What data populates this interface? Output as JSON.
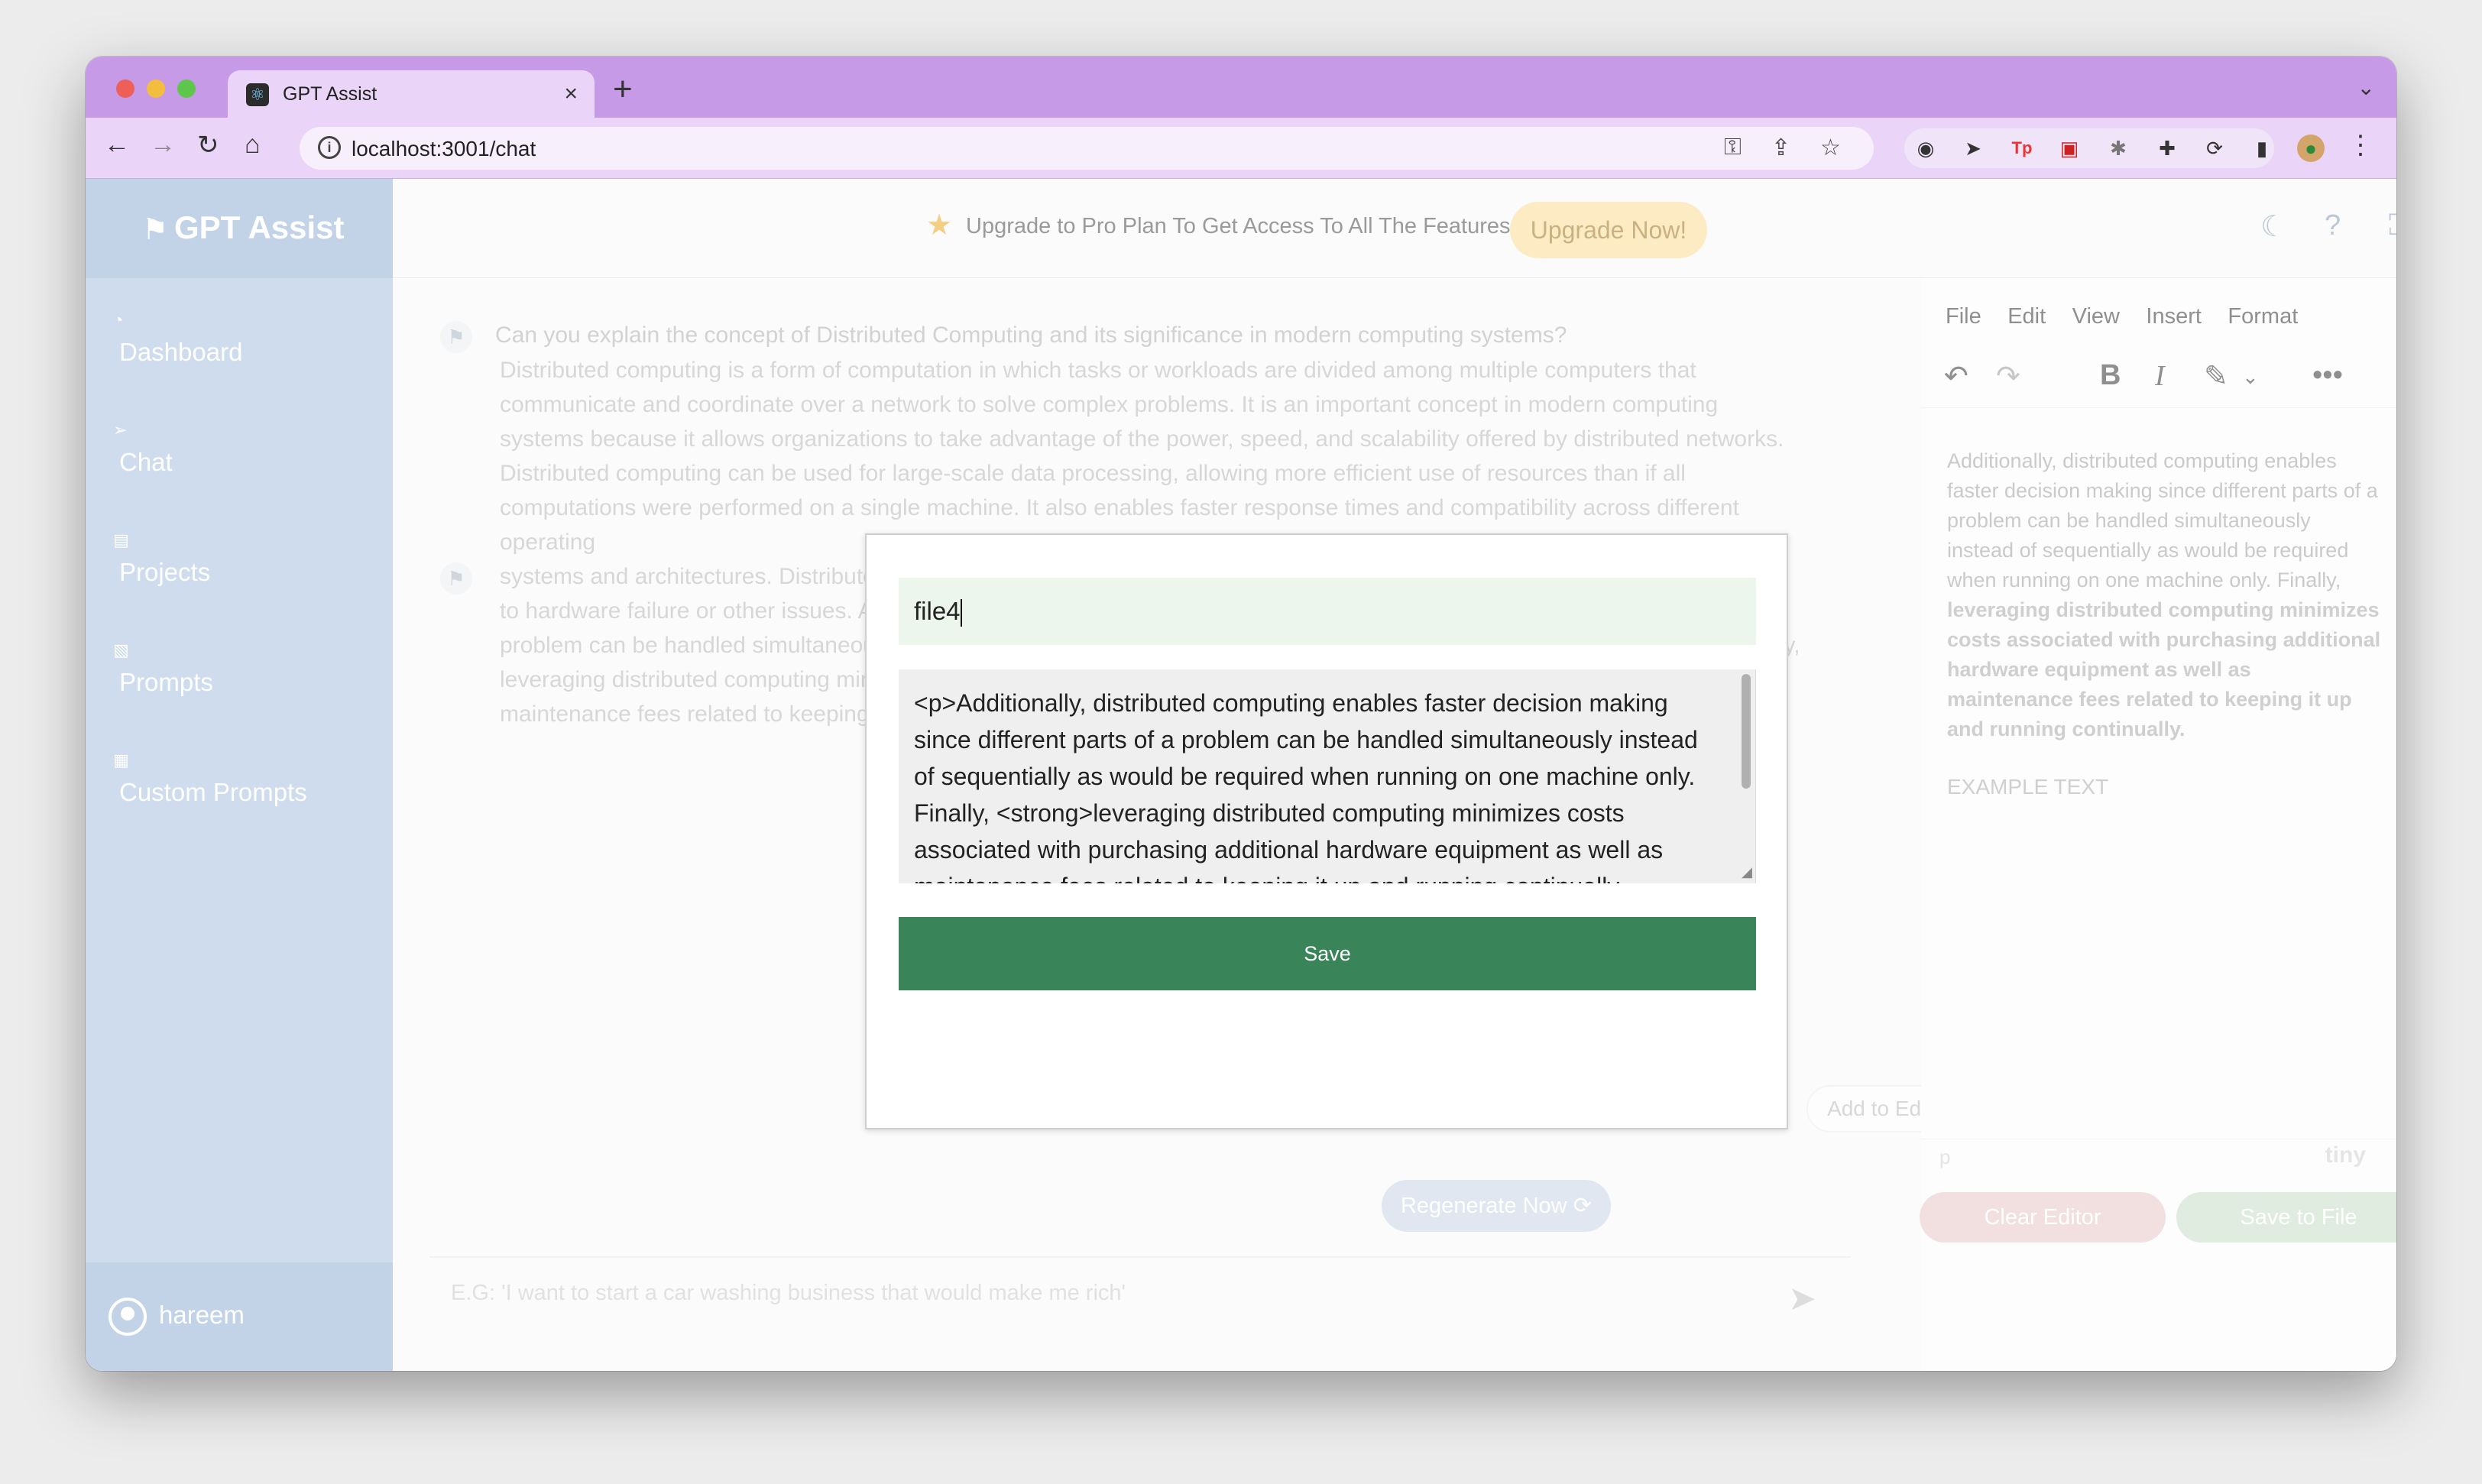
{
  "browser": {
    "tab_title": "GPT Assist",
    "tab_favicon": "react-icon",
    "url": "localhost:3001/chat",
    "close_glyph": "×",
    "new_tab_glyph": "+"
  },
  "sidebar": {
    "brand": "GPT Assist",
    "items": [
      {
        "label": "Dashboard",
        "icon": "dashboard-icon"
      },
      {
        "label": "Chat",
        "icon": "send-icon"
      },
      {
        "label": "Projects",
        "icon": "projects-icon"
      },
      {
        "label": "Prompts",
        "icon": "prompts-icon"
      },
      {
        "label": "Custom Prompts",
        "icon": "custom-prompts-icon"
      }
    ],
    "user": "hareem"
  },
  "topbar": {
    "promo": "Upgrade to Pro Plan To Get Access To All The Features",
    "upgrade_button": "Upgrade Now!"
  },
  "chat": {
    "question": "Can you explain the concept of Distributed Computing and its significance in modern computing systems?",
    "answer_lines": [
      "Distributed computing is a form of computation in which tasks or workloads are divided among multiple computers that",
      "communicate and coordinate over a network to solve complex problems. It is an important concept in modern computing",
      "systems because it allows organizations to take advantage of the power, speed, and scalability offered by distributed networks.",
      "Distributed computing can be used for large-scale data processing, allowing more efficient use of resources than if all",
      "computations were performed on a single machine. It also enables faster response times and compatibility across different operating",
      "systems and architectures. Distributed computing also improves reliability since it reduces the risk of system downtime due",
      "to hardware failure or other issues. Additionally, distributed computing enables faster decision making since different parts of a",
      "problem can be handled simultaneously instead of sequentially as would be required when running on one machine only. Finally,",
      "leveraging distributed computing minimizes costs associated with purchasing additional hardware equipment as well as",
      "maintenance fees related to keeping it up and running continually."
    ],
    "add_to_editor": "Add to Editor",
    "regenerate": "Regenerate Now",
    "input_placeholder": "E.G: 'I want to start a car washing business that would make me rich'"
  },
  "editor": {
    "menu": [
      "File",
      "Edit",
      "View",
      "Insert",
      "Format"
    ],
    "content_normal": "Additionally, distributed computing enables faster decision making since different parts of a problem can be handled simultaneously instead of sequentially as would be required when running on one machine only. Finally, ",
    "content_bold": "leveraging distributed computing minimizes costs associated with purchasing additional hardware equipment as well as maintenance fees related to keeping it up and running continually.",
    "example": "EXAMPLE TEXT",
    "status_path": "p",
    "brand": "tiny",
    "clear_button": "Clear Editor",
    "save_button": "Save to File"
  },
  "modal": {
    "filename": "file4",
    "content_lines": [
      "<p>Additionally, distributed computing enables faster decision making",
      "since different parts of a problem can be handled simultaneously instead",
      "of sequentially as would be required when running on one machine only.",
      "Finally, <strong>leveraging distributed computing minimizes costs",
      "associated with purchasing additional hardware equipment as well as",
      "maintenance fees related to keeping it up and running continually."
    ],
    "save_button": "Save"
  },
  "colors": {
    "tab_bar": "#c79ae8",
    "sidebar": "#cfdced",
    "save_green": "#398459",
    "filename_bg": "#edf6ed"
  }
}
